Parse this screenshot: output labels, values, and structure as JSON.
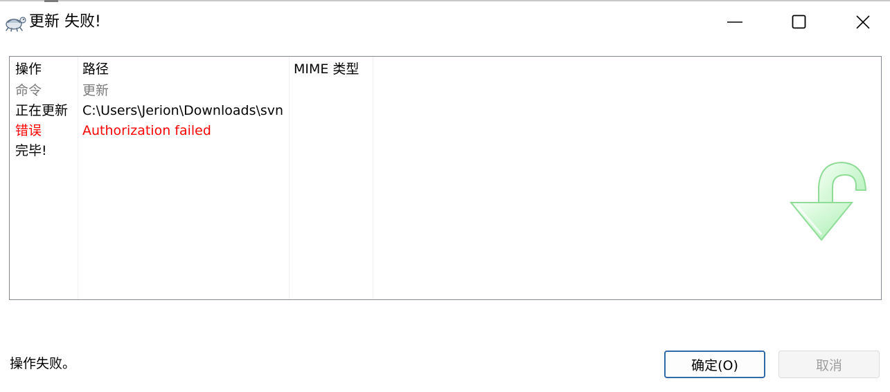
{
  "window": {
    "title": "更新 失败!",
    "app_icon": "tortoise-svn-icon",
    "controls": {
      "minimize_icon": "minimize-icon",
      "maximize_icon": "maximize-icon",
      "close_icon": "close-icon"
    }
  },
  "list": {
    "columns": [
      "操作",
      "路径",
      "MIME 类型"
    ],
    "rows": [
      {
        "action": "命令",
        "path": "更新",
        "style": "gray"
      },
      {
        "action": "正在更新",
        "path": "C:\\Users\\Jerion\\Downloads\\svn",
        "style": "normal"
      },
      {
        "action": "错误",
        "path": "Authorization failed",
        "style": "error"
      },
      {
        "action": "完毕!",
        "path": "",
        "style": "normal"
      }
    ],
    "watermark_icon": "update-arrow-icon"
  },
  "status": {
    "text": "操作失败。"
  },
  "buttons": {
    "ok_label": "确定(O)",
    "cancel_label": "取消"
  },
  "colors": {
    "error": "#ff0000",
    "muted": "#7b7b7b",
    "ok_border": "#2f6aa8",
    "arrow_green": "#7fe08a"
  }
}
